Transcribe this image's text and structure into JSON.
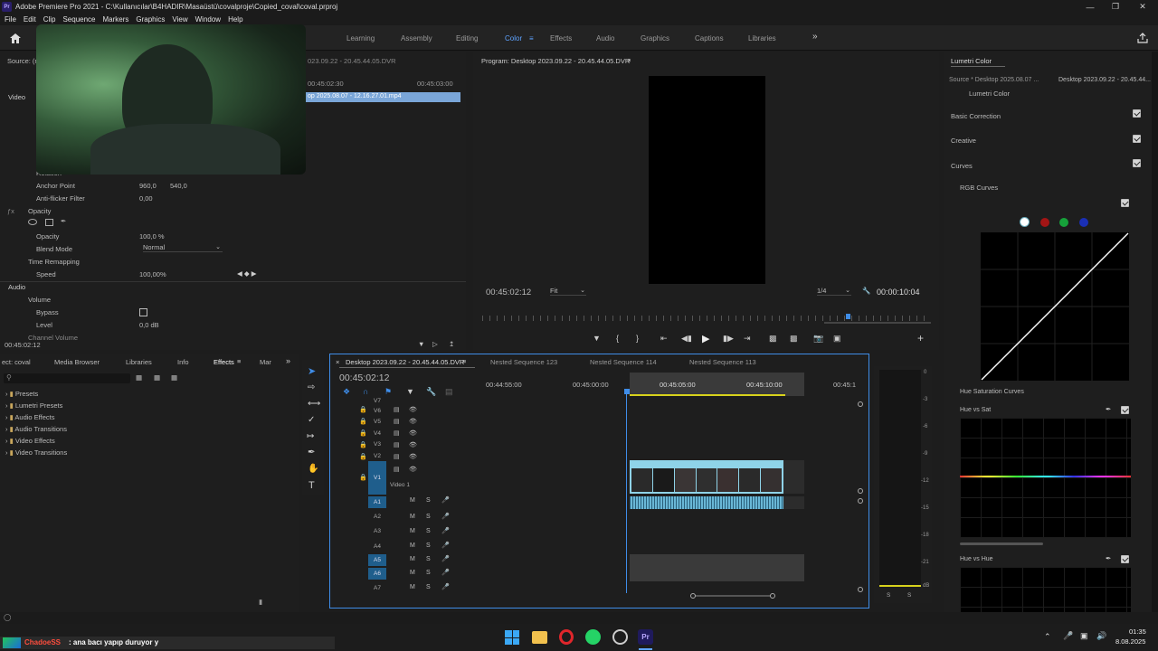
{
  "app": {
    "title": "Adobe Premiere Pro 2021 - C:\\Kullanıcılar\\B4HADIR\\Masaüstü\\covalproje\\Copied_coval\\coval.prproj",
    "logo": "Pr"
  },
  "menu": [
    "File",
    "Edit",
    "Clip",
    "Sequence",
    "Markers",
    "Graphics",
    "View",
    "Window",
    "Help"
  ],
  "workspaces": [
    "Learning",
    "Assembly",
    "Editing",
    "Color",
    "Effects",
    "Audio",
    "Graphics",
    "Captions",
    "Libraries"
  ],
  "active_workspace": "Color",
  "effect_controls": {
    "source_label": "Source: (n",
    "video_label": "Video",
    "ruler": {
      "t1": "00:45:02:30",
      "t2": "00:45:03:00",
      "t0": "023.09.22 - 20.45.44.05.DVR"
    },
    "clip_name": "op 2025.08.07 - 12.16.27.01.mp4",
    "rows": {
      "rotation": "Rotation",
      "anchor": "Anchor Point",
      "anchor_x": "960,0",
      "anchor_y": "540,0",
      "antiflicker": "Anti-flicker Filter",
      "antiflicker_v": "0,00",
      "opacity_group": "Opacity",
      "opacity": "Opacity",
      "opacity_v": "100,0 %",
      "blend": "Blend Mode",
      "blend_v": "Normal",
      "timeremap": "Time Remapping",
      "speed": "Speed",
      "speed_v": "100,00%",
      "audio": "Audio",
      "volume": "Volume",
      "bypass": "Bypass",
      "level": "Level",
      "level_v": "0,0 dB",
      "chanvol": "Channel Volume"
    },
    "timecode": "00:45:02:12"
  },
  "program": {
    "title": "Program: Desktop 2023.09.22 - 20.45.44.05.DVR",
    "timecode": "00:45:02:12",
    "fit": "Fit",
    "quality": "1/4",
    "duration": "00:00:10:04"
  },
  "lumetri": {
    "title": "Lumetri Color",
    "source": "Source * Desktop 2025.08.07 ...",
    "sequence": "Desktop 2023.09.22 - 20.45.44...",
    "effect": "Lumetri Color",
    "sections": [
      "Basic Correction",
      "Creative",
      "Curves"
    ],
    "rgb_curves": "RGB Curves",
    "hsl_curves": "Hue Saturation Curves",
    "hue_vs_sat": "Hue vs Sat",
    "hue_vs_hue": "Hue vs Hue"
  },
  "project": {
    "tabs": [
      "ect: coval",
      "Media Browser",
      "Libraries",
      "Info",
      "Effects",
      "Mar"
    ],
    "active_tab": "Effects",
    "folders": [
      "Presets",
      "Lumetri Presets",
      "Audio Effects",
      "Audio Transitions",
      "Video Effects",
      "Video Transitions"
    ]
  },
  "timeline": {
    "tabs": [
      "Desktop 2023.09.22 - 20.45.44.05.DVR",
      "Nested Sequence 123",
      "Nested Sequence 114",
      "Nested Sequence 113"
    ],
    "timecode": "00:45:02:12",
    "ruler": [
      "00:44:55:00",
      "00:45:00:00",
      "00:45:05:00",
      "00:45:10:00",
      "00:45:1"
    ],
    "video_tracks": [
      "V7",
      "V6",
      "V5",
      "V4",
      "V3",
      "V2",
      "V1"
    ],
    "video1_name": "Video 1",
    "audio_tracks": [
      "A1",
      "A2",
      "A3",
      "A4",
      "A5",
      "A6",
      "A7"
    ],
    "meter": [
      "0",
      "-3",
      "-6",
      "-9",
      "-12",
      "-15",
      "-18",
      "-21",
      "dB"
    ],
    "meter_solo": "S"
  },
  "overlay": {
    "user": "ChadoeSS",
    "message": ": ana bacı yapıp duruyor y"
  },
  "taskbar": {
    "time": "01:35",
    "date": "8.08.2025"
  },
  "colors": {
    "accent": "#3f8de8",
    "clip": "#8fd3e8",
    "audio_clip": "#69b7d6"
  }
}
